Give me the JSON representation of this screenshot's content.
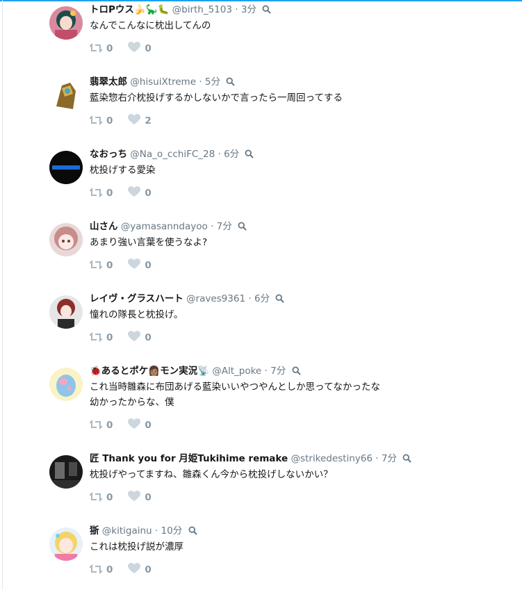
{
  "colors": {
    "accent": "#1da1f2",
    "name": "#14171a",
    "handle": "#657786",
    "action": "#aab8c2",
    "count": "#8899a6"
  },
  "tweets": [
    {
      "name": "トロPウス🍌🦕🐛",
      "handle": "@birth_5103",
      "time": "3分",
      "text": "なんでこんなに枕出してんの",
      "retweets": "0",
      "likes": "0",
      "avatar": "anime-girl-avatar"
    },
    {
      "name": "翡翠太郎",
      "handle": "@hisuiXtreme",
      "time": "5分",
      "text": "藍染惣右介枕投げするかしないかで言ったら一周回ってする",
      "retweets": "0",
      "likes": "2",
      "avatar": "armor-figure-avatar"
    },
    {
      "name": "なおっち",
      "handle": "@Na_o_cchiFC_28",
      "time": "6分",
      "text": "枕投げする愛染",
      "retweets": "0",
      "likes": "0",
      "avatar": "naocchi-logo-avatar"
    },
    {
      "name": "山さん",
      "handle": "@yamasanndayoo",
      "time": "7分",
      "text": "あまり強い言葉を使うなよ?",
      "retweets": "0",
      "likes": "0",
      "avatar": "pink-hair-avatar"
    },
    {
      "name": "レイヴ・グラスハート",
      "handle": "@raves9361",
      "time": "6分",
      "text": "憧れの隊長と枕投げ。",
      "retweets": "0",
      "likes": "0",
      "avatar": "redhead-avatar"
    },
    {
      "name": "🐞あるとポケ👩🏽モン実況📡",
      "handle": "@Alt_poke",
      "time": "7分",
      "text": "これ当時雛森に布団あげる藍染いいやつやんとしか思ってなかったな\n幼かったからな、僕",
      "retweets": "0",
      "likes": "0",
      "avatar": "pastel-blob-avatar"
    },
    {
      "name": "匠 Thank you for 月姫Tukihime remake",
      "handle": "@strikedestiny66",
      "time": "7分",
      "text": "枕投げやってますね、雛森くん今から枕投げしないかい？",
      "retweets": "0",
      "likes": "0",
      "avatar": "dark-room-avatar"
    },
    {
      "name": "狾",
      "handle": "@kitigainu",
      "time": "10分",
      "text": "これは枕投げ説が濃厚",
      "retweets": "0",
      "likes": "0",
      "avatar": "blonde-girl-avatar"
    }
  ]
}
